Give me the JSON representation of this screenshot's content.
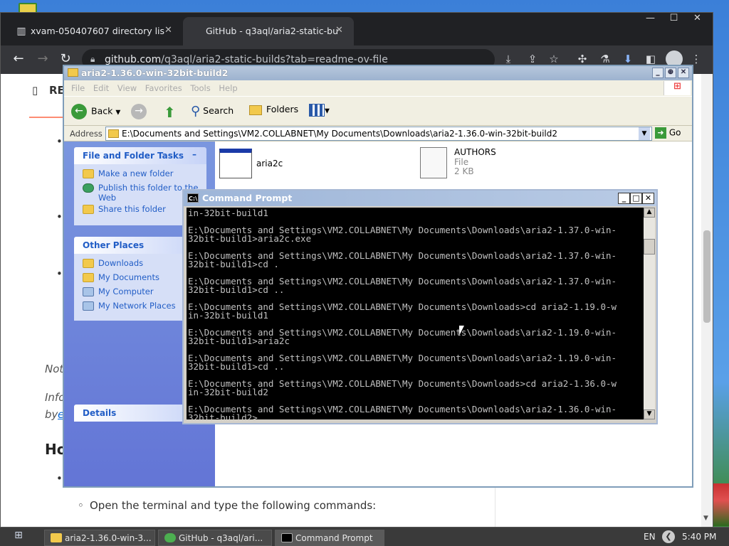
{
  "chrome": {
    "tabs": [
      {
        "title": "xvam-050407607 directory lis",
        "icon": "library-icon",
        "active": false
      },
      {
        "title": "GitHub - q3aql/aria2-static-bu",
        "icon": "github-icon",
        "active": true
      }
    ],
    "url_domain": "github.com",
    "url_path": "/q3aql/aria2-static-builds?tab=readme-ov-file",
    "page": {
      "readme_label": "RE",
      "note_fragment": "Not",
      "info_fragment": "Info",
      "by_fragment": "by",
      "by_link_fragment": "e",
      "heading_fragment": "Ho",
      "open_terminal_text": "Open the terminal and type the following commands:"
    }
  },
  "explorer": {
    "title": "aria2-1.36.0-win-32bit-build2",
    "menu": [
      "File",
      "Edit",
      "View",
      "Favorites",
      "Tools",
      "Help"
    ],
    "toolbar": {
      "back": "Back",
      "search": "Search",
      "folders": "Folders"
    },
    "address_label": "Address",
    "address": "E:\\Documents and Settings\\VM2.COLLABNET\\My Documents\\Downloads\\aria2-1.36.0-win-32bit-build2",
    "go": "Go",
    "tasks_panel": {
      "title": "File and Folder Tasks",
      "items": [
        "Make a new folder",
        "Publish this folder to the Web",
        "Share this folder"
      ]
    },
    "places_panel": {
      "title": "Other Places",
      "items": [
        "Downloads",
        "My Documents",
        "My Computer",
        "My Network Places"
      ]
    },
    "details_panel": {
      "title": "Details"
    },
    "files": [
      {
        "name": "aria2c",
        "type": "",
        "size": ""
      },
      {
        "name": "AUTHORS",
        "type": "File",
        "size": "2 KB"
      }
    ]
  },
  "cmd": {
    "title": "Command Prompt",
    "output": "in-32bit-build1\n\nE:\\Documents and Settings\\VM2.COLLABNET\\My Documents\\Downloads\\aria2-1.37.0-win-\n32bit-build1>aria2c.exe\n\nE:\\Documents and Settings\\VM2.COLLABNET\\My Documents\\Downloads\\aria2-1.37.0-win-\n32bit-build1>cd .\n\nE:\\Documents and Settings\\VM2.COLLABNET\\My Documents\\Downloads\\aria2-1.37.0-win-\n32bit-build1>cd ..\n\nE:\\Documents and Settings\\VM2.COLLABNET\\My Documents\\Downloads>cd aria2-1.19.0-w\nin-32bit-build1\n\nE:\\Documents and Settings\\VM2.COLLABNET\\My Documents\\Downloads\\aria2-1.19.0-win-\n32bit-build1>aria2c\n\nE:\\Documents and Settings\\VM2.COLLABNET\\My Documents\\Downloads\\aria2-1.19.0-win-\n32bit-build1>cd ..\n\nE:\\Documents and Settings\\VM2.COLLABNET\\My Documents\\Downloads>cd aria2-1.36.0-w\nin-32bit-build2\n\nE:\\Documents and Settings\\VM2.COLLABNET\\My Documents\\Downloads\\aria2-1.36.0-win-\n32bit-build2>"
  },
  "taskbar": {
    "items": [
      {
        "label": "aria2-1.36.0-win-3..."
      },
      {
        "label": "GitHub - q3aql/ari..."
      },
      {
        "label": "Command Prompt"
      }
    ],
    "language": "EN",
    "time": "5:40 PM"
  }
}
